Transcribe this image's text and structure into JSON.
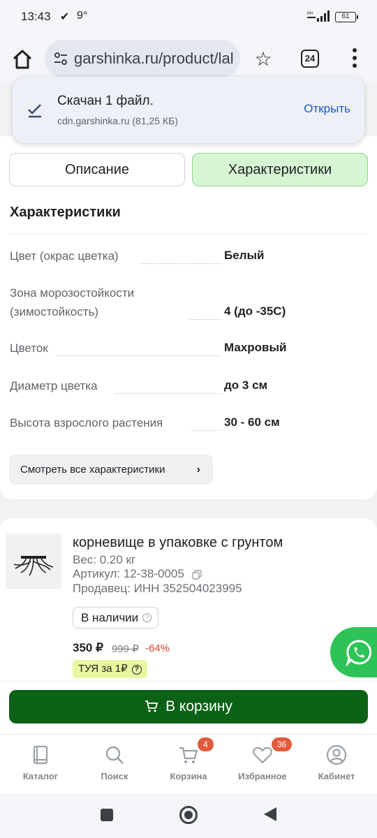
{
  "status_bar": {
    "time": "13:43",
    "temperature": "9°",
    "network": "H+",
    "battery": "61"
  },
  "browser": {
    "url": "garshinka.ru/product/lal",
    "tab_count": "24"
  },
  "download": {
    "title": "Скачан 1 файл.",
    "subtitle": "cdn.garshinka.ru (81,25 КБ)",
    "open_label": "Открыть"
  },
  "tabs": {
    "description": "Описание",
    "specs": "Характеристики"
  },
  "specs": {
    "title": "Характеристики",
    "rows": [
      {
        "label": "Цвет (окрас цветка)",
        "value": "Белый"
      },
      {
        "label": "Зона морозостойкости (зимостойкость)",
        "value": "4 (до -35С)"
      },
      {
        "label": "Цветок",
        "value": "Махровый"
      },
      {
        "label": "Диаметр цветка",
        "value": "до 3 см"
      },
      {
        "label": "Высота взрослого растения",
        "value": "30 - 60 см"
      }
    ],
    "all_button": "Смотреть все характеристики"
  },
  "product": {
    "title": "корневище в упаковке с грунтом",
    "weight": "Вес: 0.20 кг",
    "sku": "Артикул: 12-38-0005",
    "seller": "Продавец: ИНН 352504023995",
    "stock": "В наличии",
    "price": "350 ₽",
    "old_price": "999 ₽",
    "discount": "-64%",
    "promo": "ТУЯ за 1₽"
  },
  "cart_button": "В корзину",
  "bottom_nav": [
    {
      "label": "Каталог",
      "icon": "catalog-book-icon"
    },
    {
      "label": "Поиск",
      "icon": "search-icon"
    },
    {
      "label": "Корзина",
      "icon": "cart-icon",
      "badge": "4"
    },
    {
      "label": "Избранное",
      "icon": "heart-icon",
      "badge": "36"
    },
    {
      "label": "Кабинет",
      "icon": "user-icon"
    }
  ]
}
